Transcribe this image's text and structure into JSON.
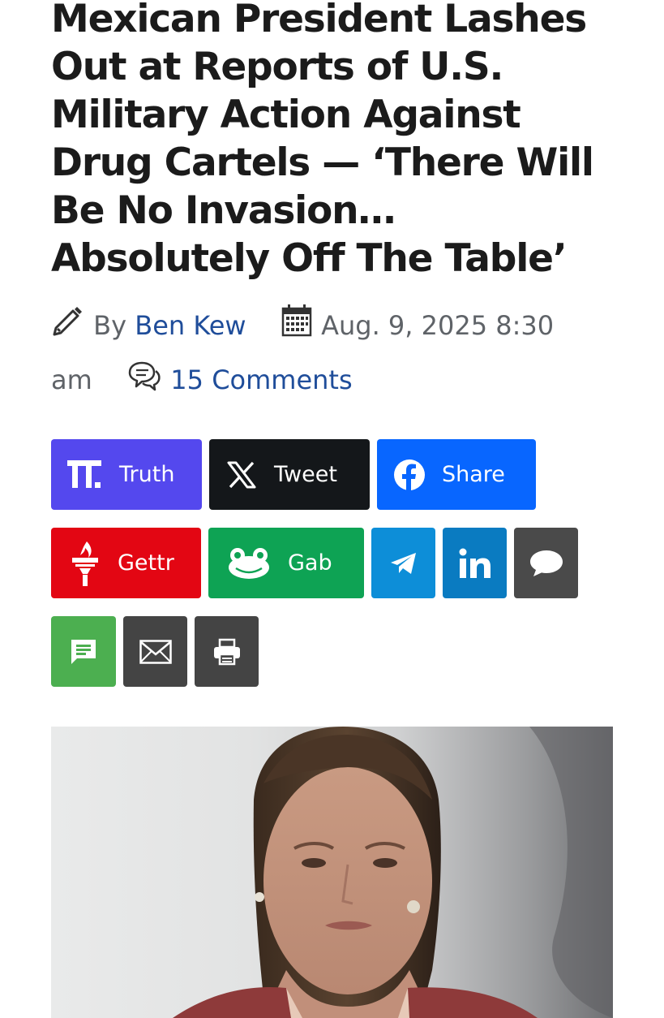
{
  "article": {
    "headline": "Mexican President Lashes Out at Reports of U.S. Military Action Against Drug Cartels — ‘There Will Be No Invasion… Absolutely Off The Table’",
    "by_label": "By",
    "author": "Ben Kew",
    "date_line1": "Aug. 9, 2025 8:30",
    "date_line2": "am",
    "comments": "15 Comments"
  },
  "share": {
    "truth": "Truth",
    "tweet": "Tweet",
    "facebook": "Share",
    "gettr": "Gettr",
    "gab": "Gab"
  },
  "icons": [
    "pencil-icon",
    "calendar-icon",
    "comments-icon",
    "truth-social-icon",
    "x-icon",
    "facebook-icon",
    "gettr-icon",
    "gab-icon",
    "telegram-icon",
    "linkedin-icon",
    "chat-bubble-icon",
    "sms-icon",
    "email-icon",
    "print-icon"
  ],
  "colors": {
    "truth": "#5448ee",
    "tweet": "#14171a",
    "facebook": "#0866ff",
    "gettr": "#e30613",
    "gab": "#0ea354",
    "telegram": "#0d8ed8",
    "linkedin": "#0a7bc1",
    "comment": "#4a4a4a",
    "sms": "#4caf50",
    "email": "#444444",
    "print": "#444444",
    "link": "#1f4d9a"
  }
}
